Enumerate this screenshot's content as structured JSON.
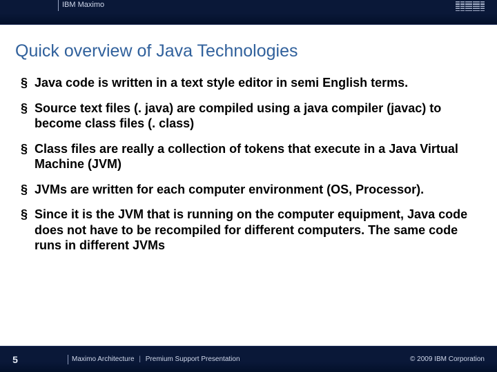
{
  "header": {
    "product": "IBM Maximo",
    "logo_alt": "IBM"
  },
  "title": "Quick overview of Java Technologies",
  "bullets": [
    "Java code is written in a text style editor in semi English terms.",
    "Source text files (. java) are compiled using a java compiler (javac) to become class files (. class)",
    "Class files are really a collection of tokens that execute in a Java Virtual Machine (JVM)",
    "JVMs are written for each computer environment (OS, Processor).",
    "Since it is the JVM that is running on the computer equipment, Java code does not have to be recompiled for different computers.  The same code runs in different JVMs"
  ],
  "footer": {
    "page": "5",
    "crumb1": "Maximo Architecture",
    "crumb2": "Premium Support Presentation",
    "copyright": "© 2009 IBM Corporation"
  }
}
